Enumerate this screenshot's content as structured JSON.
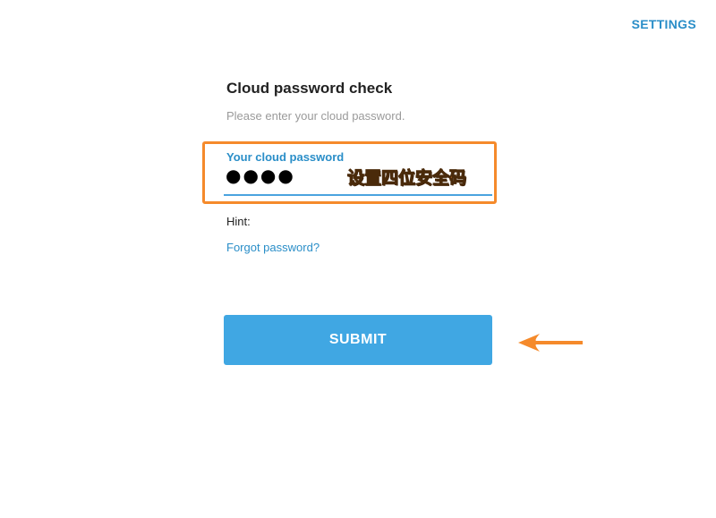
{
  "header": {
    "settings_label": "SETTINGS"
  },
  "form": {
    "title": "Cloud password check",
    "subtitle": "Please enter your cloud password.",
    "password_label": "Your cloud password",
    "password_value": "●●●●",
    "hint_label": "Hint:",
    "forgot_label": "Forgot password?",
    "submit_label": "SUBMIT"
  },
  "annotations": {
    "password_note": "设置四位安全码",
    "highlight_color": "#f58a2b",
    "arrow_color": "#f58a2b"
  },
  "colors": {
    "accent": "#2a8ec8",
    "button": "#40a7e3"
  }
}
